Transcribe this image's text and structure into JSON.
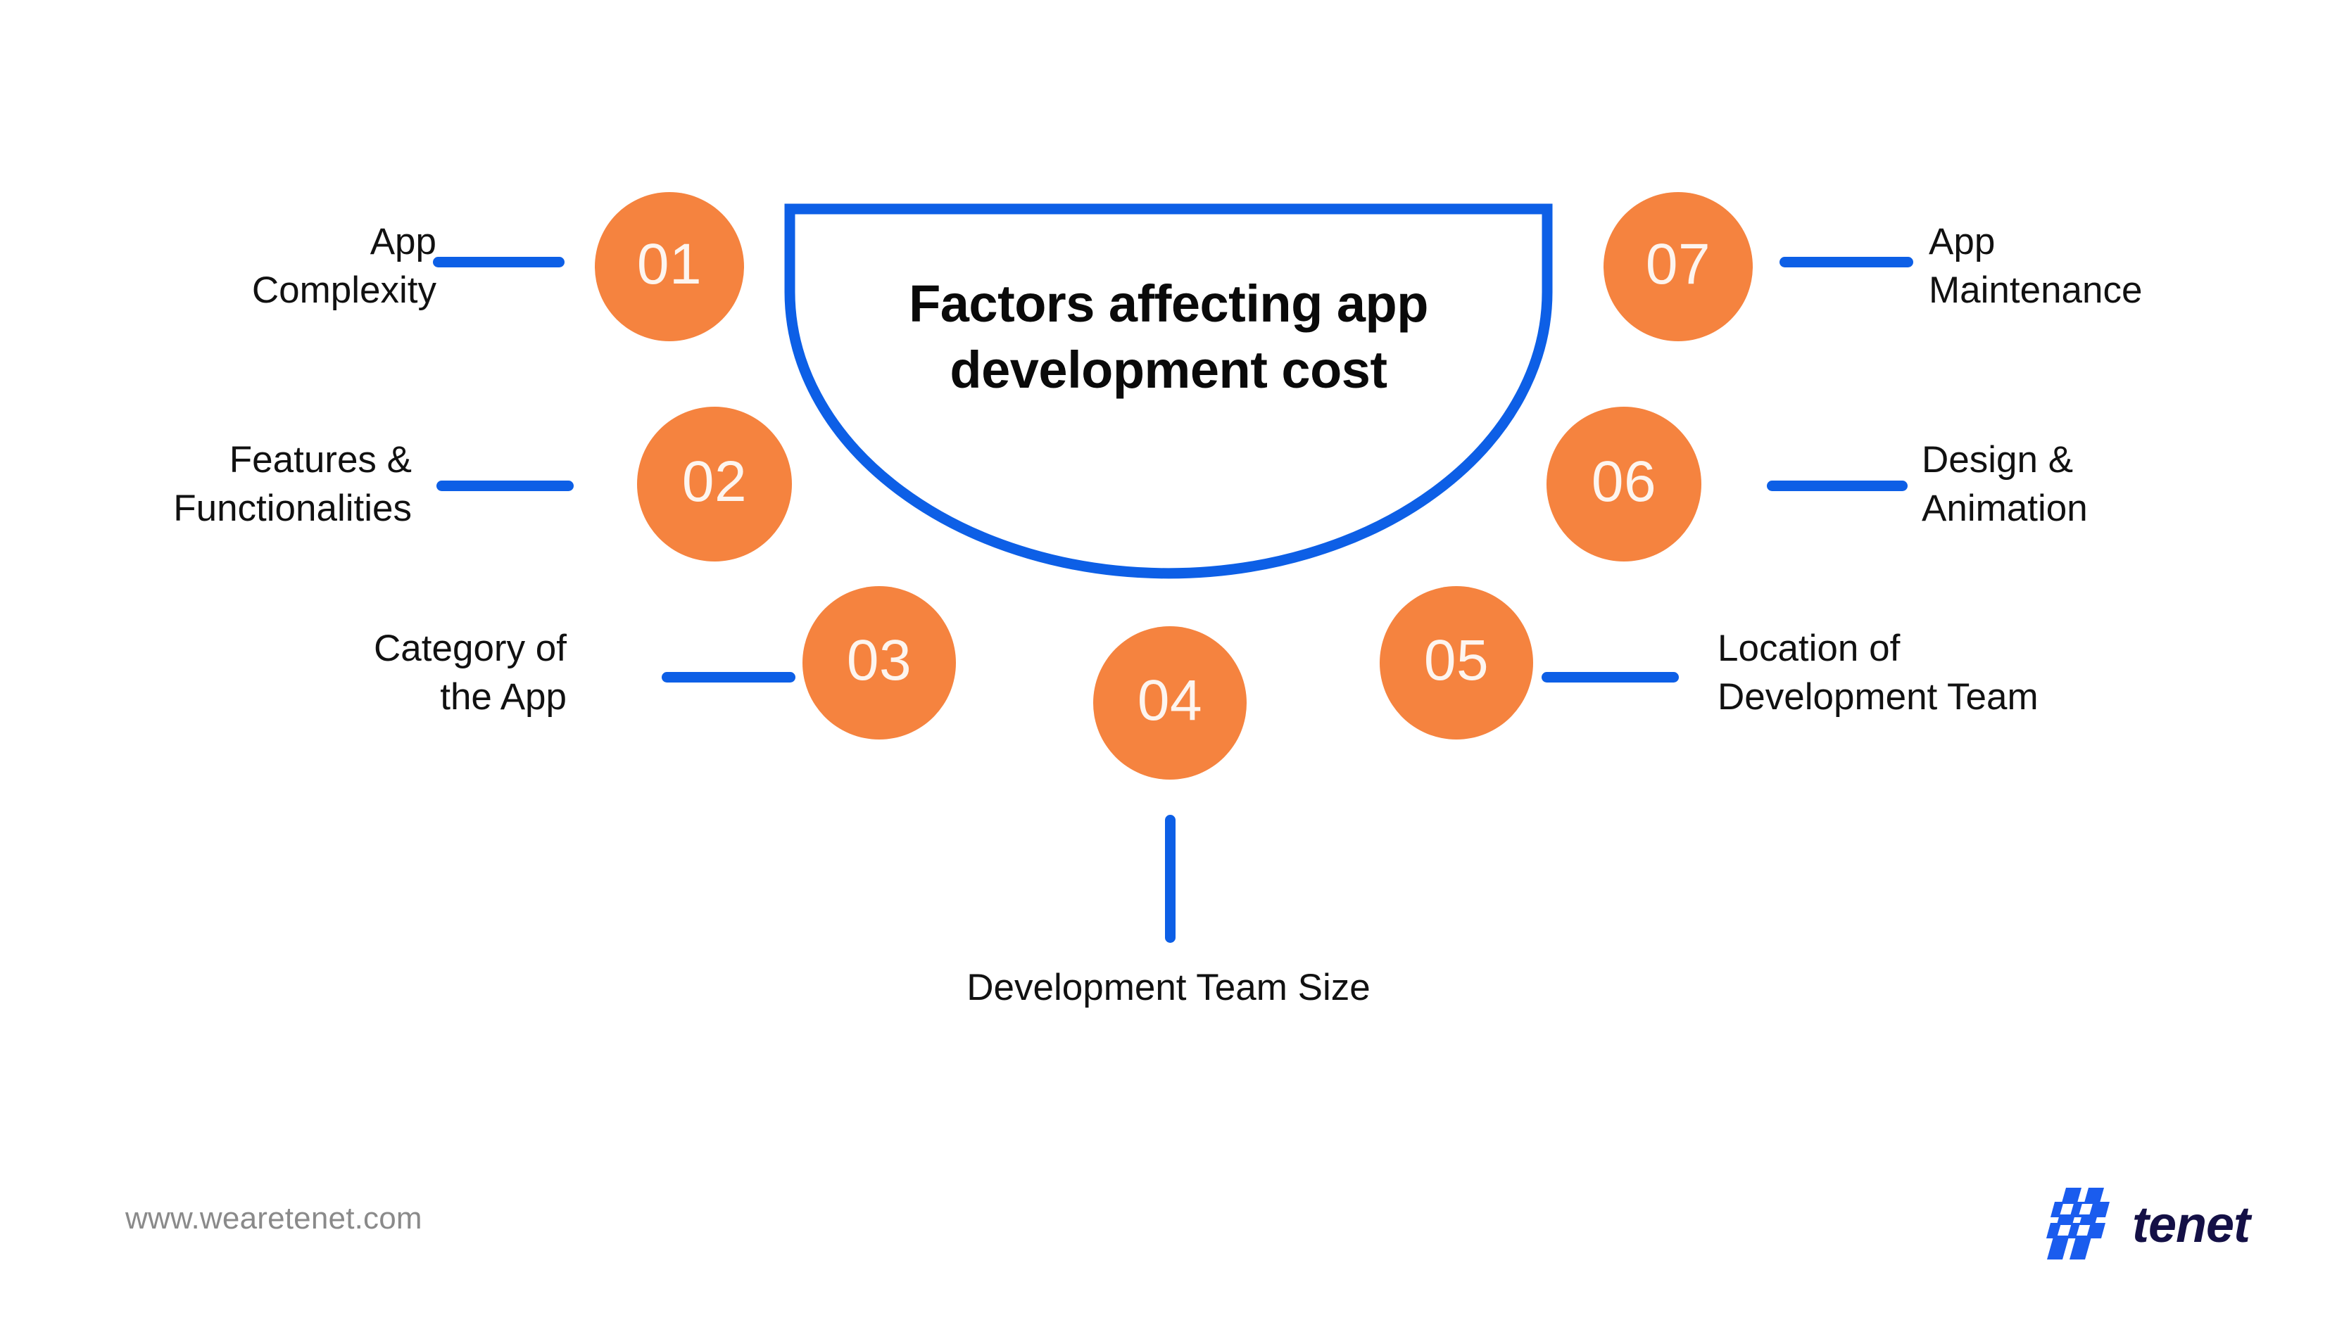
{
  "center": {
    "title": "Factors affecting\napp development\ncost",
    "shape": "semicircle-bowl",
    "outline_color": "#0D5FE6"
  },
  "theme": {
    "accent_orange": "#F5833F",
    "accent_blue": "#0D5FE6",
    "text_color": "#111111",
    "background": "#FFFFFF",
    "footer_text_color": "#8A8A8A",
    "brand_word_color": "#141046"
  },
  "factors": [
    {
      "number": "01",
      "label": "App\nComplexity",
      "side": "left"
    },
    {
      "number": "02",
      "label": "Features &\nFunctionalities",
      "side": "left"
    },
    {
      "number": "03",
      "label": "Category of\nthe App",
      "side": "left"
    },
    {
      "number": "04",
      "label": "Development Team Size",
      "side": "bottom"
    },
    {
      "number": "05",
      "label": "Location of\nDevelopment Team",
      "side": "right"
    },
    {
      "number": "06",
      "label": "Design &\nAnimation",
      "side": "right"
    },
    {
      "number": "07",
      "label": "App\nMaintenance",
      "side": "right"
    }
  ],
  "footer": {
    "url": "www.wearetenet.com",
    "brand_name": "tenet",
    "brand_mark_icon": "tenet-lattice-logo-icon"
  }
}
